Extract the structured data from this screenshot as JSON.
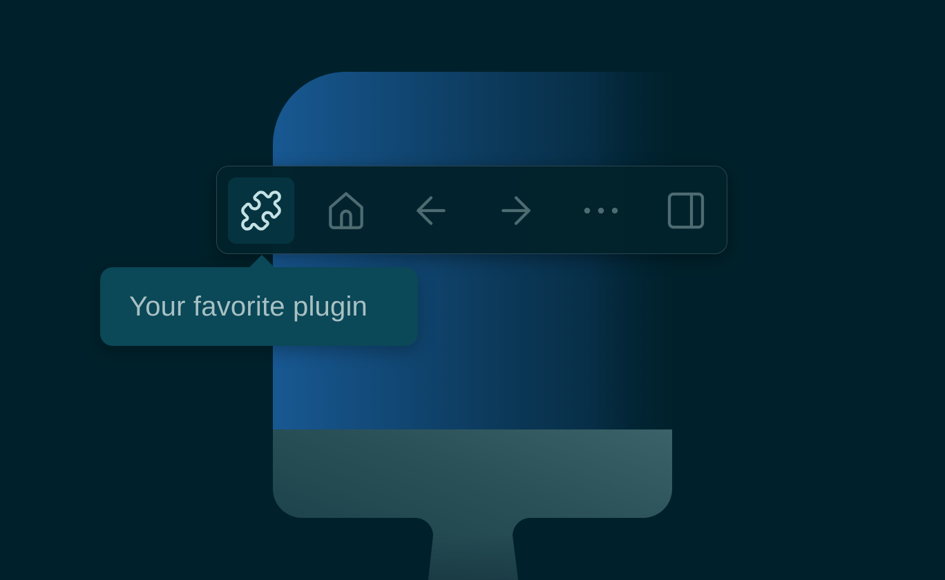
{
  "toolbar": {
    "buttons": [
      {
        "icon": "puzzle-piece-icon",
        "active": true
      },
      {
        "icon": "home-icon",
        "active": false
      },
      {
        "icon": "arrow-left-icon",
        "active": false
      },
      {
        "icon": "arrow-right-icon",
        "active": false
      },
      {
        "icon": "more-horizontal-icon",
        "active": false
      },
      {
        "icon": "sidebar-right-icon",
        "active": false
      }
    ]
  },
  "tooltip": {
    "text": "Your favorite plugin"
  },
  "colors": {
    "background": "#00212b",
    "toolbar_border": "#2a4650",
    "active_icon": "#c4e2e5",
    "inactive_icon": "#4d6b71",
    "tooltip_bg": "#0b4858",
    "tooltip_text": "#a8c1c3"
  }
}
